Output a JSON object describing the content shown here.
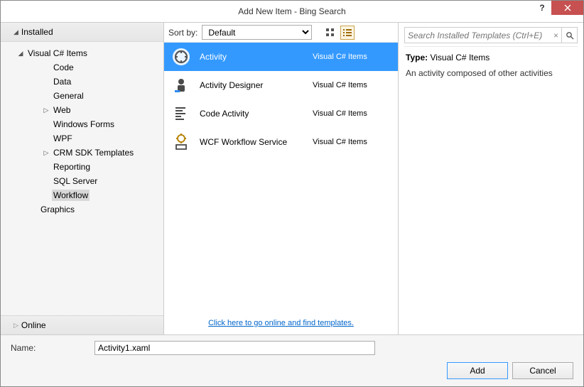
{
  "window": {
    "title": "Add New Item - Bing Search"
  },
  "sidebar": {
    "header": "Installed",
    "online": "Online",
    "root": "Visual C# Items",
    "items": [
      "Code",
      "Data",
      "General",
      "Web",
      "Windows Forms",
      "WPF",
      "CRM SDK Templates",
      "Reporting",
      "SQL Server",
      "Workflow"
    ],
    "extra": "Graphics",
    "expandable": {
      "Web": true,
      "CRM SDK Templates": true
    },
    "selected": "Workflow"
  },
  "toolbar": {
    "sort_label": "Sort by:",
    "sort_value": "Default",
    "search_placeholder": "Search Installed Templates (Ctrl+E)"
  },
  "templates": [
    {
      "name": "Activity",
      "category": "Visual C# Items",
      "icon": "activity",
      "selected": true
    },
    {
      "name": "Activity Designer",
      "category": "Visual C# Items",
      "icon": "designer"
    },
    {
      "name": "Code Activity",
      "category": "Visual C# Items",
      "icon": "code"
    },
    {
      "name": "WCF Workflow Service",
      "category": "Visual C# Items",
      "icon": "service"
    }
  ],
  "online_link": "Click here to go online and find templates.",
  "details": {
    "type_label": "Type:",
    "type_value": "Visual C# Items",
    "description": "An activity composed of other activities"
  },
  "name_row": {
    "label": "Name:",
    "value": "Activity1.xaml"
  },
  "buttons": {
    "add": "Add",
    "cancel": "Cancel"
  }
}
